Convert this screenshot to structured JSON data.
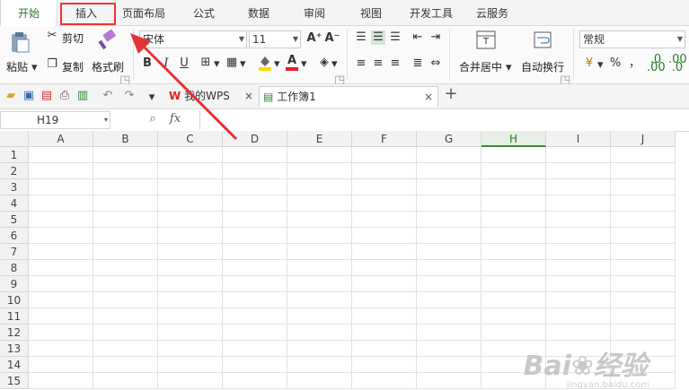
{
  "menu": {
    "tabs": [
      {
        "label": "开始",
        "active": true
      },
      {
        "label": "插入",
        "active": false,
        "highlighted": true
      },
      {
        "label": "页面布局",
        "active": false
      },
      {
        "label": "公式",
        "active": false
      },
      {
        "label": "数据",
        "active": false
      },
      {
        "label": "审阅",
        "active": false
      },
      {
        "label": "视图",
        "active": false
      },
      {
        "label": "开发工具",
        "active": false
      },
      {
        "label": "云服务",
        "active": false
      }
    ]
  },
  "ribbon": {
    "paste_label": "粘贴",
    "cut_label": "剪切",
    "copy_label": "复制",
    "format_painter_label": "格式刷",
    "font_name": "宋体",
    "font_size": "11",
    "merge_center_label": "合并居中",
    "wrap_text_label": "自动换行",
    "number_format": "常规",
    "percent_symbol": "%",
    "comma_symbol": "，",
    "bold": "B",
    "italic": "I",
    "underline": "U",
    "grow_font": "A⁺",
    "shrink_font": "A⁻",
    "font_color_letter": "A"
  },
  "quickbar": {
    "tabs": [
      {
        "label": "我的WPS"
      },
      {
        "label": "工作簿1"
      }
    ],
    "close_glyph": "×",
    "new_tab_glyph": "+"
  },
  "formula_bar": {
    "name_box": "H19",
    "fx_label": "fx"
  },
  "sheet": {
    "columns": [
      "A",
      "B",
      "C",
      "D",
      "E",
      "F",
      "G",
      "H",
      "I",
      "J"
    ],
    "selected_column": "H",
    "rows": [
      "1",
      "2",
      "3",
      "4",
      "5",
      "6",
      "7",
      "8",
      "9",
      "10",
      "11",
      "12",
      "13",
      "14",
      "15"
    ]
  },
  "watermark": {
    "text": "Bai 经验",
    "sub": "jingyan.baidu.com"
  },
  "colors": {
    "accent": "#2a7a2a",
    "annotation": "#e33333",
    "fill_yellow": "#ffd800",
    "font_red": "#e02020"
  }
}
